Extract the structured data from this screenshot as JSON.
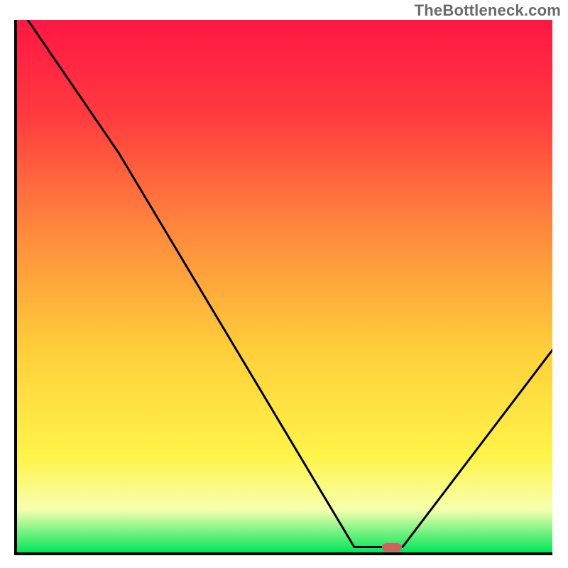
{
  "watermark": "TheBottleneck.com",
  "colors": {
    "gradient_stops": [
      {
        "offset": "0%",
        "color": "#ff1744"
      },
      {
        "offset": "18%",
        "color": "#ff3b3f"
      },
      {
        "offset": "40%",
        "color": "#ff8a3d"
      },
      {
        "offset": "62%",
        "color": "#ffcf3a"
      },
      {
        "offset": "82%",
        "color": "#fff44a"
      },
      {
        "offset": "92%",
        "color": "#f7ffae"
      },
      {
        "offset": "100%",
        "color": "#00e65a"
      }
    ],
    "curve": "#000000",
    "marker": "#d2605e",
    "axis": "#000000"
  },
  "chart_data": {
    "type": "line",
    "title": "",
    "xlabel": "",
    "ylabel": "",
    "xlim": [
      0,
      100
    ],
    "ylim": [
      0,
      100
    ],
    "x": [
      2,
      19,
      63,
      68,
      72,
      100
    ],
    "values": [
      100,
      75,
      1,
      1,
      1,
      38
    ],
    "marker": {
      "x": 70,
      "y": 1
    }
  }
}
